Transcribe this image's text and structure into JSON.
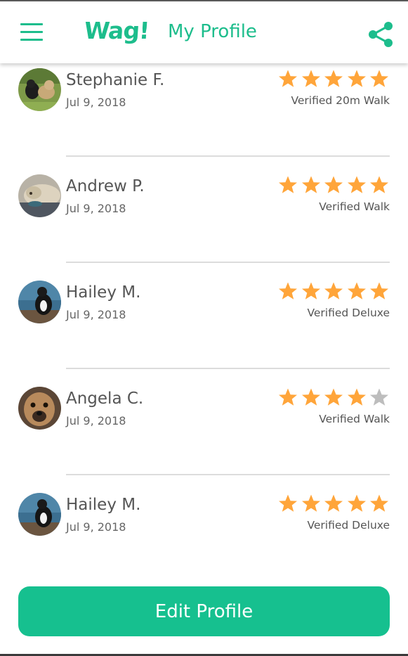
{
  "app": {
    "logo_text": "Wag!",
    "title": "My Profile",
    "accent_color": "#1dbd8c",
    "star_color": "#ffa53a",
    "empty_star_color": "#bdbdbd",
    "menu_icon": "hamburger-menu-icon",
    "share_icon": "share-icon"
  },
  "reviews": [
    {
      "name": "Stephanie F.",
      "date": "Jul 9, 2018",
      "rating": 5,
      "label": "Verified 20m Walk",
      "avatar": "dogs-on-grass-photo"
    },
    {
      "name": "Andrew P.",
      "date": "Jul 9, 2018",
      "rating": 5,
      "label": "Verified Walk",
      "avatar": "sleeping-dog-photo"
    },
    {
      "name": "Hailey M.",
      "date": "Jul 9, 2018",
      "rating": 5,
      "label": "Verified Deluxe",
      "avatar": "dog-by-lake-photo"
    },
    {
      "name": "Angela C.",
      "date": "Jul 9, 2018",
      "rating": 4,
      "label": "Verified Walk",
      "avatar": "dog-face-photo"
    },
    {
      "name": "Hailey M.",
      "date": "Jul 9, 2018",
      "rating": 5,
      "label": "Verified Deluxe",
      "avatar": "dog-by-lake-photo"
    }
  ],
  "footer": {
    "edit_button_label": "Edit Profile"
  }
}
